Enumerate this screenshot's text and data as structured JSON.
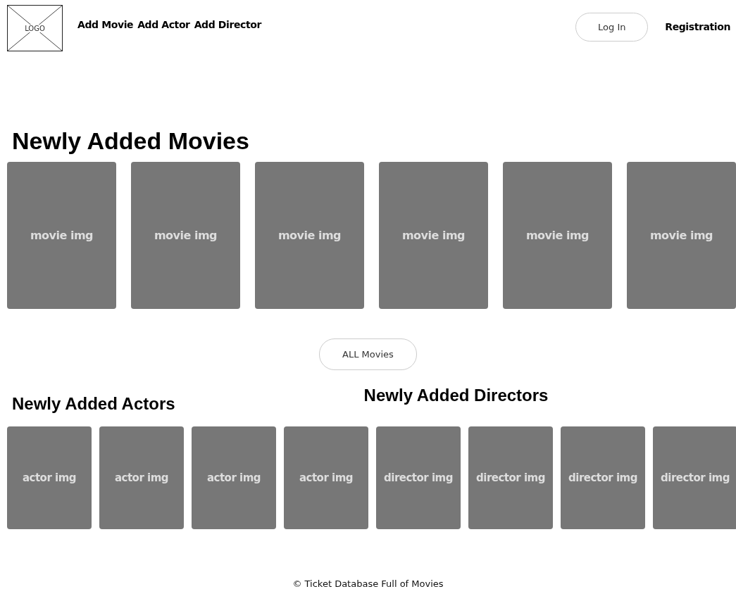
{
  "header": {
    "logo": "LOGO",
    "nav": [
      "Add Movie",
      "Add Actor",
      "Add Director"
    ],
    "login": "Log In",
    "registration": "Registration"
  },
  "movies": {
    "title": "Newly Added Movies",
    "cards": [
      "movie img",
      "movie img",
      "movie img",
      "movie img",
      "movie img",
      "movie img"
    ],
    "button": "ALL Movies"
  },
  "actors": {
    "title": "Newly Added Actors",
    "cards": [
      "actor img",
      "actor img",
      "actor img",
      "actor img"
    ]
  },
  "directors": {
    "title": "Newly Added Directors",
    "cards": [
      "director img",
      "director img",
      "director img",
      "director img"
    ]
  },
  "footer": "© Ticket Database Full of Movies"
}
